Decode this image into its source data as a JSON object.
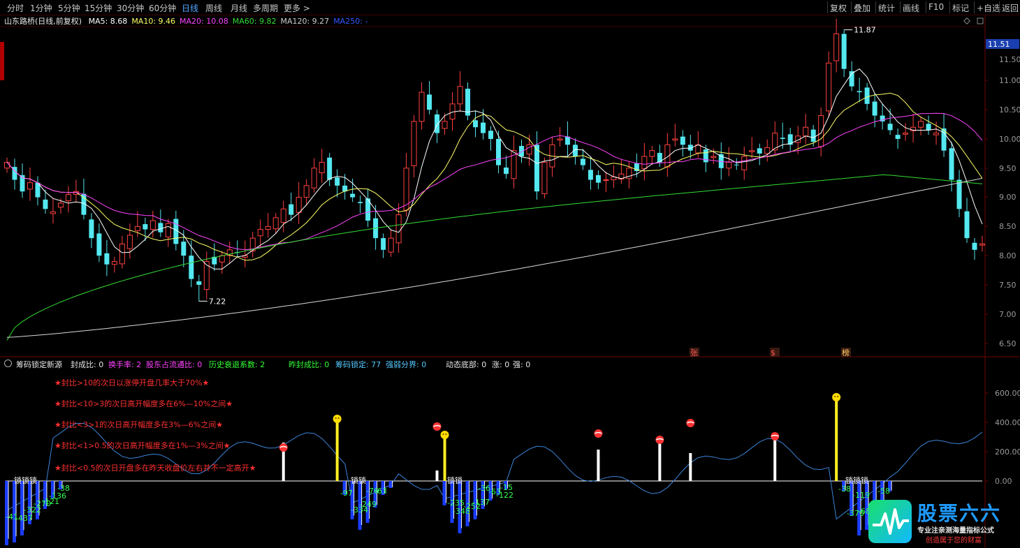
{
  "toolbar": {
    "periods": [
      "分时",
      "1分钟",
      "5分钟",
      "15分钟",
      "30分钟",
      "60分钟",
      "日线",
      "周线",
      "月线",
      "多周期",
      "更多 >"
    ],
    "active_period": "日线",
    "tools": [
      "复权",
      "叠加",
      "统计",
      "画线",
      "F10",
      "标记",
      "+自选",
      "返回"
    ]
  },
  "stock": {
    "title": "山东路桥(日线,前复权)"
  },
  "ma_legend": [
    {
      "label": "MA5: 8.68",
      "color": "#ffffff"
    },
    {
      "label": "MA10: 9.46",
      "color": "#ffff66"
    },
    {
      "label": "MA20: 10.08",
      "color": "#ff44ff"
    },
    {
      "label": "MA60: 9.82",
      "color": "#33dd33"
    },
    {
      "label": "MA120: 9.27",
      "color": "#cccccc"
    },
    {
      "label": "MA250: -",
      "color": "#3355ff"
    }
  ],
  "price_axis": {
    "labels": [
      "11.51",
      "11.50",
      "11.00",
      "10.50",
      "10.00",
      "9.50",
      "9.00",
      "8.50",
      "8.00",
      "7.50",
      "7.00",
      "6.50"
    ],
    "current": "11.51"
  },
  "markers": {
    "high": "11.87",
    "low": "7.22",
    "zhang": "张",
    "dollar": "$",
    "bang": "榜"
  },
  "indicator": {
    "name": "筹码锁定新源",
    "fields": [
      {
        "label": "封成比: 0",
        "color": "#e6e6e6"
      },
      {
        "label": "换手率: 2",
        "color": "#ff44ff"
      },
      {
        "label": "股东占流通比: 0",
        "color": "#ff44ff"
      },
      {
        "label": "历史衰退系数: 2",
        "color": "#33ff33"
      },
      {
        "label": "昨封成比: 0",
        "color": "#33ff33"
      },
      {
        "label": "筹码锁定: 77",
        "color": "#56c8ff"
      },
      {
        "label": "强弱分界: 0",
        "color": "#56c8ff"
      },
      {
        "label": "动态底部: 0",
        "color": "#e6e6e6"
      },
      {
        "label": "涨: 0",
        "color": "#e6e6e6"
      },
      {
        "label": "强: 0",
        "color": "#e6e6e6"
      }
    ],
    "notes": [
      "★封比>10的次日以涨停开盘几率大于70%★",
      "★封比<10>3的次日高开幅度多在6%—10%之间★",
      "★封比<3>1的次日高开幅度多在3%—6%之间★",
      "★封比<1>0.5的次日高开幅度多在1%—3%之间★",
      "★封比<0.5的次日开盘多在昨天收盘价左右并不一定高开★"
    ],
    "axis": [
      "600.00",
      "400.00",
      "200.00",
      "0.00"
    ],
    "lock_label": "锁锁锁",
    "lock_label2": "锁锁",
    "neg_labels": [
      "-41",
      "-437",
      "-322",
      "-270",
      "-121",
      "-136",
      "-38",
      "-97",
      "-334",
      "-249",
      "-76",
      "-63",
      "-235",
      "-348",
      "-252",
      "-137",
      "-36",
      "-63",
      "-15",
      "-122",
      "-38",
      "-370",
      "-68",
      "-119",
      "-58"
    ]
  },
  "brand": {
    "title": "股票六六",
    "sub1": "专业注亲测海量指标公式",
    "sub2": "创造属于您的财富"
  }
}
